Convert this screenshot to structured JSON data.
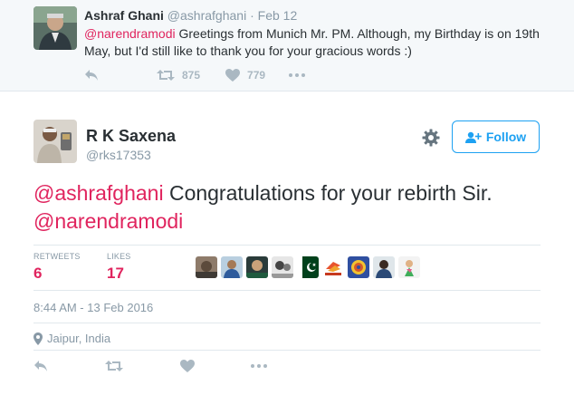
{
  "parent_tweet": {
    "author_name": "Ashraf Ghani",
    "author_handle": "@ashrafghani",
    "separator": "·",
    "date": "Feb 12",
    "mention": "@narendramodi",
    "text": " Greetings from Munich Mr. PM. Although, my Birthday is on 19th May, but I'd still like to thank you for your gracious words :)",
    "retweet_count": "875",
    "like_count": "779"
  },
  "main_tweet": {
    "author_name": "R K Saxena",
    "author_handle": "@rks17353",
    "follow_label": "Follow",
    "mention_1": "@ashrafghani",
    "text": " Congratulations for your rebirth Sir.",
    "mention_2": "@narendramodi",
    "retweets_label": "RETWEETS",
    "retweets_value": "6",
    "likes_label": "LIKES",
    "likes_value": "17",
    "timestamp": "8:44 AM - 13 Feb 2016",
    "location": "Jaipur, India"
  },
  "icons": {
    "reply": "reply-icon",
    "retweet": "retweet-icon",
    "like": "heart-icon",
    "more": "more-icon",
    "settings": "gear-icon",
    "follow": "add-user-icon",
    "location": "location-pin-icon"
  },
  "colors": {
    "mention": "#e0245e",
    "follow_blue": "#1da1f2",
    "muted": "#8899a6",
    "icon_gray": "#aab8c2",
    "parent_bg": "#f5f8fa",
    "divider": "#e1e8ed"
  },
  "liker_avatars": [
    "avatar-1",
    "avatar-2",
    "avatar-3",
    "avatar-4",
    "avatar-5",
    "avatar-6",
    "avatar-7",
    "avatar-8",
    "avatar-9"
  ]
}
